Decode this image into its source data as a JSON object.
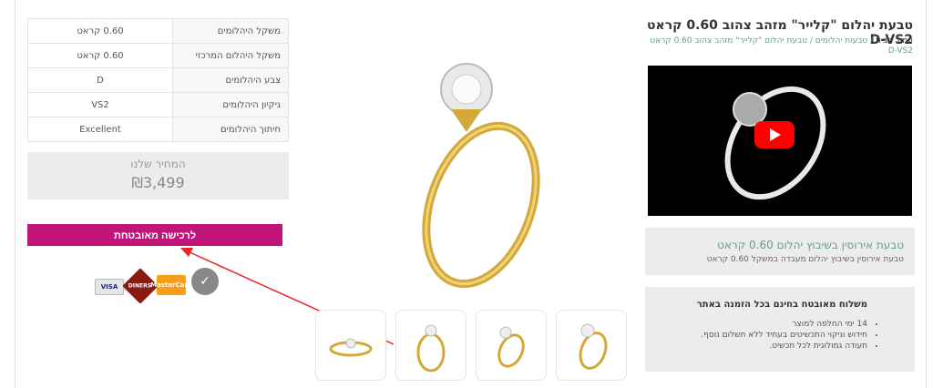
{
  "specs": [
    {
      "label": "משקל היהלומים",
      "value": "0.60 קראט"
    },
    {
      "label": "משקל היהלום המרכזי",
      "value": "0.60 קראט"
    },
    {
      "label": "צבע היהלומים",
      "value": "D"
    },
    {
      "label": "ניקיון היהלומים",
      "value": "VS2"
    },
    {
      "label": "חיתוך היהלומים",
      "value": "Excellent"
    }
  ],
  "price": {
    "label": "המחיר שלנו",
    "value": "₪3,499"
  },
  "buy_button": "לרכישה מאובטחת",
  "payments": [
    "VISA",
    "DINERS",
    "MasterCard",
    "✓"
  ],
  "product": {
    "title": "טבעת יהלום \"קלייר\" מזהב צהוב 0.60 קראט D-VS2",
    "breadcrumb": {
      "home": "עמוד הבית",
      "sep": " / ",
      "cat": "טבעות יהלומים",
      "item": "טבעת יהלום \"קלייר\" מזהב צהוב 0.60 קראט D-VS2"
    }
  },
  "promo": {
    "title": "טבעת אירוסין בשיבוץ יהלום 0.60 קראט",
    "sub": "טבעת אירוסין בשיבוץ יהלום מעבדה במשקל 0.60 קראט"
  },
  "shipping": {
    "title": "משלוח מאובטח בחינם בכל הזמנה באתר",
    "items": [
      "14 ימי החלפה למוצר",
      "חידוש וניקוי התכשיטים בעתיד ללא תשלום נוסף.",
      "תעודה גמולוגית לכל תכשיט."
    ]
  },
  "colors": {
    "accent": "#c2157a",
    "link": "#6b9b8a",
    "arrow": "#e8232a"
  }
}
